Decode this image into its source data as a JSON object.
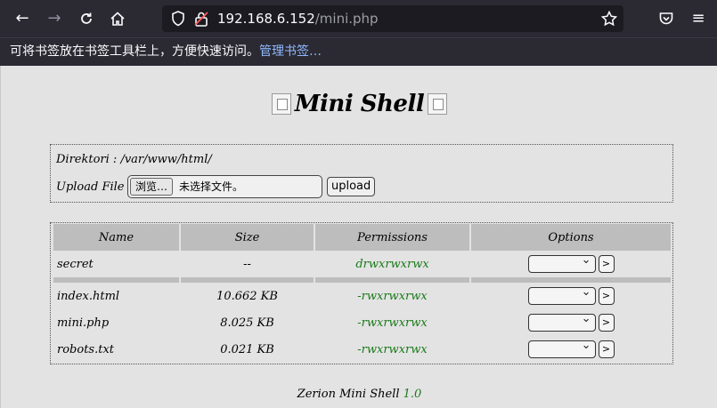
{
  "browser": {
    "url_host": "192.168.6.152",
    "url_path": "/mini.php",
    "bookmarks_text": "可将书签放在书签工具栏上，方便快速访问。",
    "bookmarks_link": "管理书签…"
  },
  "page": {
    "title": "Mini Shell",
    "directory_label": "Direktori : ",
    "directory_value": "/var/www/html/",
    "upload_label": "Upload File :",
    "browse_label": "浏览…",
    "no_file_label": "未选择文件。",
    "upload_button": "upload"
  },
  "table": {
    "headers": [
      "Name",
      "Size",
      "Permissions",
      "Options"
    ],
    "rows": [
      {
        "name": "secret",
        "size": "--",
        "perm": "drwxrwxrwx"
      },
      {
        "name": "index.html",
        "size": "10.662 KB",
        "perm": "-rwxrwxrwx"
      },
      {
        "name": "mini.php",
        "size": "8.025 KB",
        "perm": "-rwxrwxrwx"
      },
      {
        "name": "robots.txt",
        "size": "0.021 KB",
        "perm": "-rwxrwxrwx"
      }
    ],
    "go_label": ">"
  },
  "footer": {
    "text": "Zerion Mini Shell ",
    "version": "1.0"
  }
}
